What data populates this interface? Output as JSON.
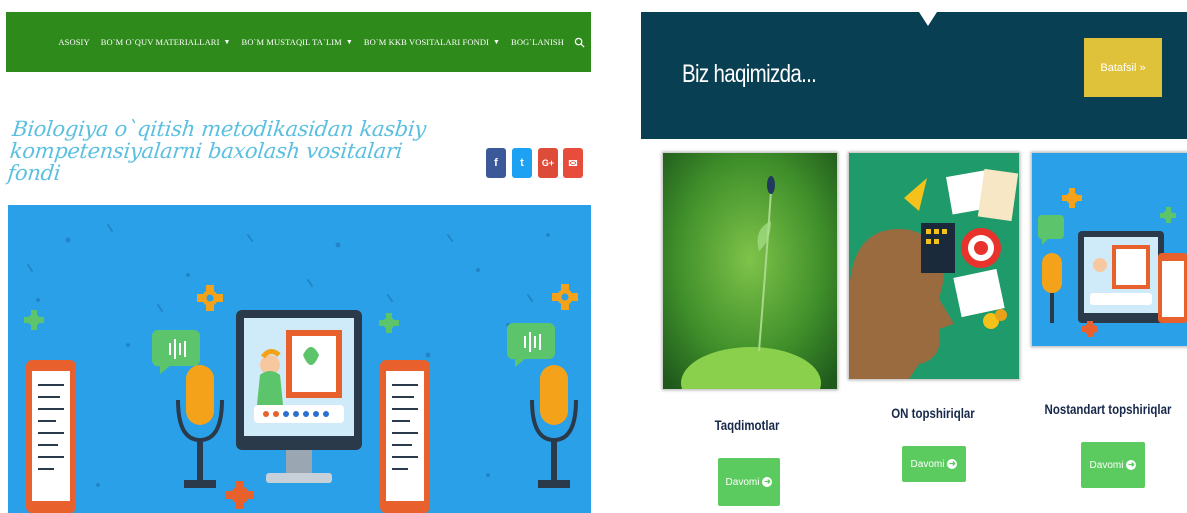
{
  "nav": {
    "items": [
      {
        "label": "ASOSIY",
        "has_dropdown": false
      },
      {
        "label": "BO`M O`QUV MATERIALLARI",
        "has_dropdown": true
      },
      {
        "label": "BO`M MUSTAQIL TA`LIM",
        "has_dropdown": true
      },
      {
        "label": "BO`M KKB VOSITALARI FONDI",
        "has_dropdown": true
      },
      {
        "label": "BOG`LANISH",
        "has_dropdown": false
      }
    ],
    "search_icon": "search-icon",
    "color": "#2f8a1c"
  },
  "site": {
    "title_line1": "Biologiya o`qitish metodikasidan kasbiy",
    "title_line2": "kompetensiyalarni baxolash vositalari fondi",
    "title_color": "#5bc0e0"
  },
  "social": [
    {
      "glyph": "f",
      "icon": "facebook-icon",
      "color": "#3b5998"
    },
    {
      "glyph": "t",
      "icon": "twitter-icon",
      "color": "#1da1f2"
    },
    {
      "glyph": "G+",
      "icon": "google-plus-icon",
      "color": "#dd4b39"
    },
    {
      "glyph": "✉",
      "icon": "mail-icon",
      "color": "#e74c3c"
    }
  ],
  "about": {
    "title": "Biz haqimizda...",
    "button_label": "Batafsil »",
    "bg_color": "#083f52",
    "button_color": "#e0c23a"
  },
  "cards": [
    {
      "title": "Taqdimotlar",
      "button_label": "Davomi"
    },
    {
      "title": "ON topshiriqlar",
      "button_label": "Davomi"
    },
    {
      "title": "Nostandart topshiriqlar",
      "button_label": "Davomi"
    }
  ],
  "colors": {
    "button_green": "#5ccb5f",
    "card_title": "#17284a"
  }
}
